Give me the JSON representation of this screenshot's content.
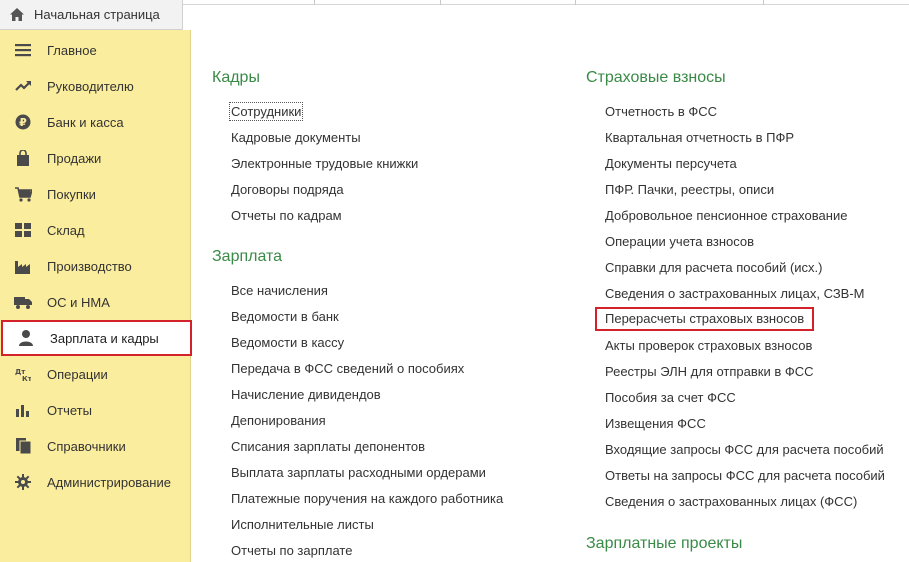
{
  "top": {
    "home_tab": "Начальная страница"
  },
  "sidebar": {
    "items": [
      {
        "label": "Главное",
        "icon": "menu-lines-icon"
      },
      {
        "label": "Руководителю",
        "icon": "trend-chart-icon"
      },
      {
        "label": "Банк и касса",
        "icon": "ruble-coin-icon"
      },
      {
        "label": "Продажи",
        "icon": "shopping-bag-icon"
      },
      {
        "label": "Покупки",
        "icon": "cart-icon"
      },
      {
        "label": "Склад",
        "icon": "warehouse-grid-icon"
      },
      {
        "label": "Производство",
        "icon": "factory-icon"
      },
      {
        "label": "ОС и НМА",
        "icon": "truck-icon"
      },
      {
        "label": "Зарплата и кадры",
        "icon": "person-icon",
        "active": true
      },
      {
        "label": "Операции",
        "icon": "debit-credit-icon"
      },
      {
        "label": "Отчеты",
        "icon": "bar-chart-icon"
      },
      {
        "label": "Справочники",
        "icon": "books-icon"
      },
      {
        "label": "Администрирование",
        "icon": "gear-icon"
      }
    ]
  },
  "left_column": {
    "kadry": {
      "title": "Кадры",
      "links": [
        "Сотрудники",
        "Кадровые документы",
        "Электронные трудовые книжки",
        "Договоры подряда",
        "Отчеты по кадрам"
      ]
    },
    "zarplata": {
      "title": "Зарплата",
      "links": [
        "Все начисления",
        "Ведомости в банк",
        "Ведомости в кассу",
        "Передача в ФСС сведений о пособиях",
        "Начисление дивидендов",
        "Депонирования",
        "Списания зарплаты депонентов",
        "Выплата зарплаты расходными ордерами",
        "Платежные поручения на каждого работника",
        "Исполнительные листы",
        "Отчеты по зарплате"
      ]
    }
  },
  "right_column": {
    "vznosy": {
      "title": "Страховые взносы",
      "links": [
        "Отчетность в ФСС",
        "Квартальная отчетность в ПФР",
        "Документы персучета",
        "ПФР. Пачки, реестры, описи",
        "Добровольное пенсионное страхование",
        "Операции учета взносов",
        "Справки для расчета пособий (исх.)",
        "Сведения о застрахованных лицах, СЗВ-М",
        "Перерасчеты страховых взносов",
        "Акты проверок страховых взносов",
        "Реестры ЭЛН для отправки в ФСС",
        "Пособия за счет ФСС",
        "Извещения ФСС",
        "Входящие запросы ФСС для расчета пособий",
        "Ответы на запросы ФСС для расчета пособий",
        "Сведения о застрахованных лицах (ФСС)"
      ]
    },
    "projects": {
      "title": "Зарплатные проекты"
    }
  },
  "colors": {
    "accent_green": "#3a8a47",
    "sidebar_bg": "#fbed9e",
    "highlight_red": "#d3222a"
  }
}
